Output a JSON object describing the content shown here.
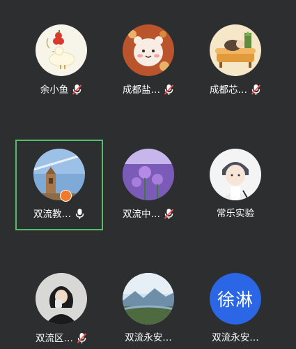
{
  "participants": [
    {
      "name": "余小鱼",
      "mic": "muted-icon"
    },
    {
      "name": "成都盐…",
      "mic": "muted-icon"
    },
    {
      "name": "成都芯…",
      "mic": "muted-icon"
    },
    {
      "name": "双流教…",
      "mic": "mic-icon",
      "speaking": true,
      "host": true
    },
    {
      "name": "双流中…",
      "mic": "muted-icon"
    },
    {
      "name": "常乐实验",
      "mic": "none"
    },
    {
      "name": "双流区…",
      "mic": "muted-icon"
    },
    {
      "name": "双流永安…",
      "mic": "none"
    },
    {
      "name": "双流永安…",
      "mic": "none",
      "initials": "徐淋"
    }
  ],
  "colors": {
    "background": "#2d2e30",
    "active_border": "#4fbf6a",
    "muted_slash": "#ff4d4f",
    "initials_bg": "#2b66e6",
    "host_badge": "#f07a2b"
  }
}
